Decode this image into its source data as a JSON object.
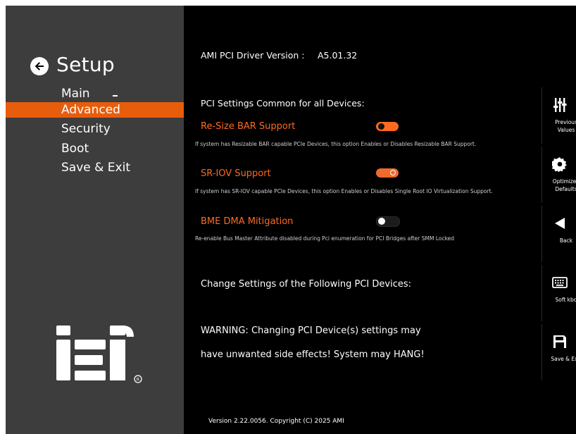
{
  "sidebar": {
    "title": "Setup",
    "menu": [
      {
        "label": "Main"
      },
      {
        "label": "Advanced"
      },
      {
        "label": "Security"
      },
      {
        "label": "Boot"
      },
      {
        "label": "Save & Exit"
      }
    ],
    "active_index": 1,
    "accent_color": "#e85d0c"
  },
  "main": {
    "driver_version_label": "AMI PCI Driver Version :",
    "driver_version_value": "A5.01.32",
    "section_title": "PCI Settings Common for all Devices:",
    "settings": [
      {
        "name": "Re-Size BAR Support",
        "state": "off",
        "description": "If system has Resizable BAR capable PCIe Devices, this option Enables or Disables Resizable BAR Support."
      },
      {
        "name": "SR-IOV Support",
        "state": "on",
        "description": "If system has SR-IOV capable PCIe Devices, this option Enables or Disables Single Root IO Virtualization Support."
      },
      {
        "name": "BME DMA Mitigation",
        "state": "off",
        "description": "Re-enable Bus Master Attribute disabled during Pci enumeration for PCI Bridges after SMM Locked"
      }
    ],
    "change_settings_title": "Change Settings of the Following PCI Devices:",
    "warning_line1": "WARNING: Changing PCI Device(s) settings may",
    "warning_line2": "have unwanted side effects! System may HANG!",
    "footer": "Version 2.22.0056. Copyright (C) 2025 AMI"
  },
  "right_panel": {
    "buttons": [
      {
        "label": "Previous Values",
        "icon": "sliders-icon"
      },
      {
        "label": "Optimized Defaults",
        "icon": "gear-icon"
      },
      {
        "label": "Back",
        "icon": "triangle-left-icon"
      },
      {
        "label": "Soft kbd",
        "icon": "keyboard-icon"
      },
      {
        "label": "Save & Exit",
        "icon": "floppy-disk-icon"
      }
    ]
  },
  "logo_text": "iEi"
}
